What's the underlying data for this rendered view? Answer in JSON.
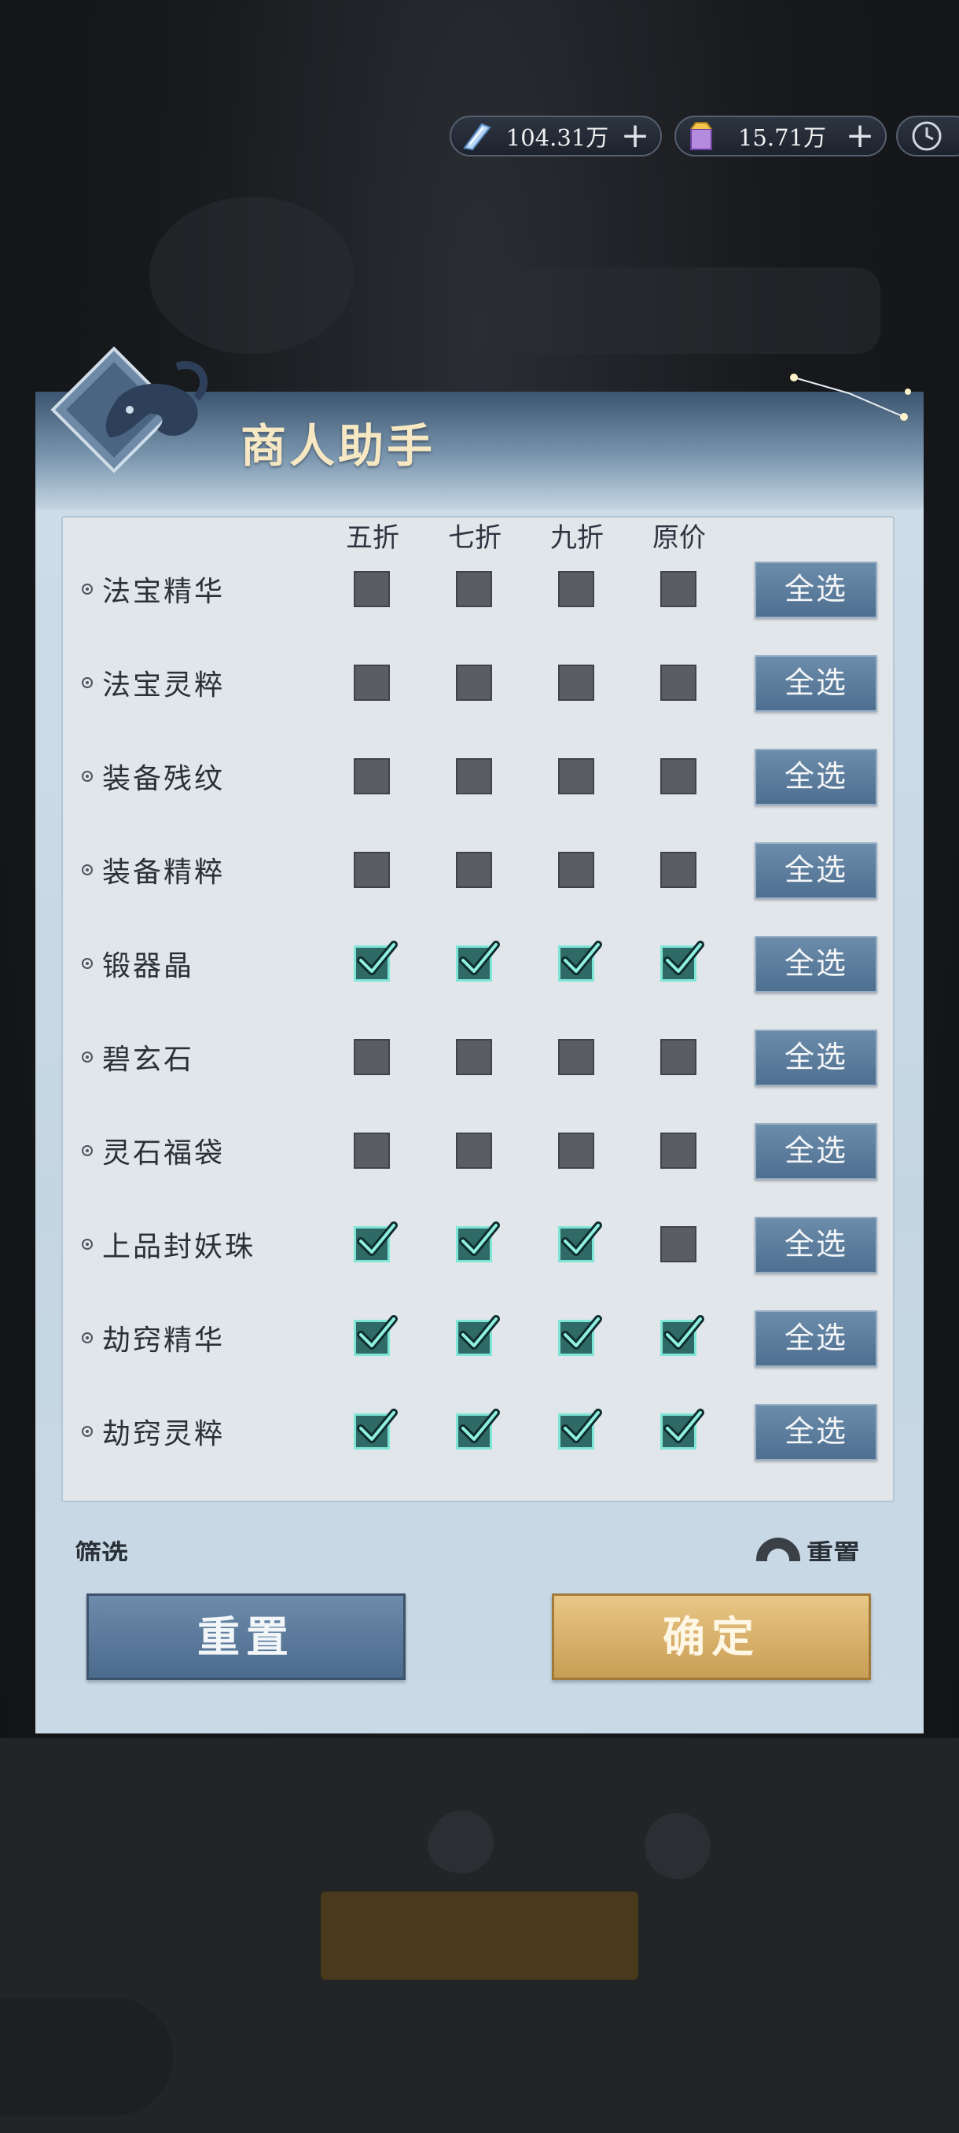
{
  "currency": [
    {
      "icon": "crystal-feather-icon",
      "value": "104.31万",
      "plus": "+"
    },
    {
      "icon": "treasure-box-icon",
      "value": "15.71万",
      "plus": "+"
    }
  ],
  "clock_icon": "clock-icon",
  "dialog": {
    "title": "商人助手",
    "emblem_icon": "fox-beast-icon",
    "columns": [
      "五折",
      "七折",
      "九折",
      "原价"
    ],
    "select_all_label": "全选",
    "items": [
      {
        "name": "法宝精华",
        "checks": [
          false,
          false,
          false,
          false
        ]
      },
      {
        "name": "法宝灵粹",
        "checks": [
          false,
          false,
          false,
          false
        ]
      },
      {
        "name": "装备残纹",
        "checks": [
          false,
          false,
          false,
          false
        ]
      },
      {
        "name": "装备精粹",
        "checks": [
          false,
          false,
          false,
          false
        ]
      },
      {
        "name": "锻器晶",
        "checks": [
          true,
          true,
          true,
          true
        ]
      },
      {
        "name": "碧玄石",
        "checks": [
          false,
          false,
          false,
          false
        ]
      },
      {
        "name": "灵石福袋",
        "checks": [
          false,
          false,
          false,
          false
        ]
      },
      {
        "name": "上品封妖珠",
        "checks": [
          true,
          true,
          true,
          false
        ]
      },
      {
        "name": "劫窍精华",
        "checks": [
          true,
          true,
          true,
          true
        ]
      },
      {
        "name": "劫窍灵粹",
        "checks": [
          true,
          true,
          true,
          true
        ]
      }
    ],
    "partial_left_text": "筛选",
    "partial_right_text": "重置",
    "reset_label": "重置",
    "confirm_label": "确定"
  },
  "colors": {
    "header_dark": "#3c5570",
    "panel_bg": "#c5d6e3",
    "checkbox_on": "#7fe6d7",
    "checkbox_off": "#5a5d63",
    "select_btn": "#5a7b9c",
    "confirm_gold": "#d8b16c"
  }
}
